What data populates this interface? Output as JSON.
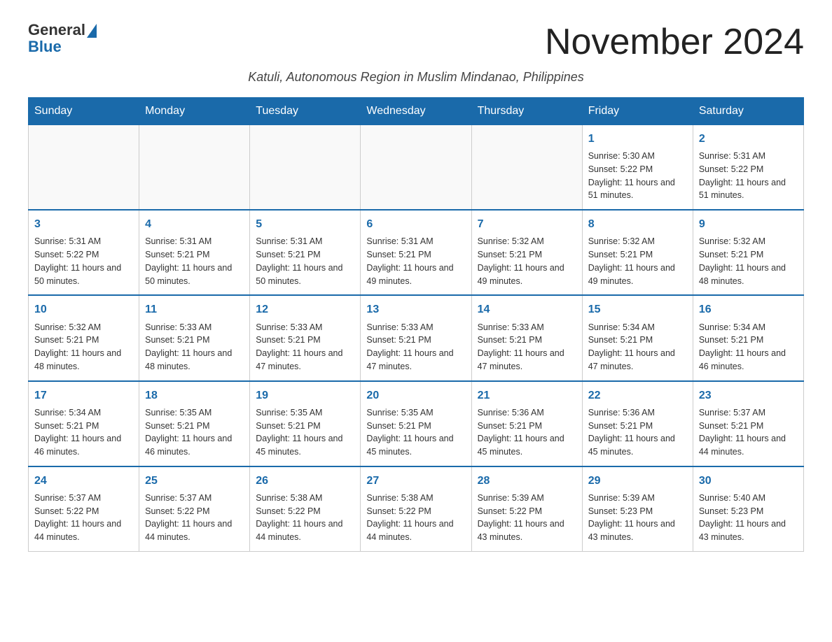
{
  "header": {
    "logo_general": "General",
    "logo_blue": "Blue",
    "month_title": "November 2024",
    "subtitle": "Katuli, Autonomous Region in Muslim Mindanao, Philippines"
  },
  "weekdays": [
    "Sunday",
    "Monday",
    "Tuesday",
    "Wednesday",
    "Thursday",
    "Friday",
    "Saturday"
  ],
  "weeks": [
    [
      {
        "day": "",
        "info": ""
      },
      {
        "day": "",
        "info": ""
      },
      {
        "day": "",
        "info": ""
      },
      {
        "day": "",
        "info": ""
      },
      {
        "day": "",
        "info": ""
      },
      {
        "day": "1",
        "info": "Sunrise: 5:30 AM\nSunset: 5:22 PM\nDaylight: 11 hours and 51 minutes."
      },
      {
        "day": "2",
        "info": "Sunrise: 5:31 AM\nSunset: 5:22 PM\nDaylight: 11 hours and 51 minutes."
      }
    ],
    [
      {
        "day": "3",
        "info": "Sunrise: 5:31 AM\nSunset: 5:22 PM\nDaylight: 11 hours and 50 minutes."
      },
      {
        "day": "4",
        "info": "Sunrise: 5:31 AM\nSunset: 5:21 PM\nDaylight: 11 hours and 50 minutes."
      },
      {
        "day": "5",
        "info": "Sunrise: 5:31 AM\nSunset: 5:21 PM\nDaylight: 11 hours and 50 minutes."
      },
      {
        "day": "6",
        "info": "Sunrise: 5:31 AM\nSunset: 5:21 PM\nDaylight: 11 hours and 49 minutes."
      },
      {
        "day": "7",
        "info": "Sunrise: 5:32 AM\nSunset: 5:21 PM\nDaylight: 11 hours and 49 minutes."
      },
      {
        "day": "8",
        "info": "Sunrise: 5:32 AM\nSunset: 5:21 PM\nDaylight: 11 hours and 49 minutes."
      },
      {
        "day": "9",
        "info": "Sunrise: 5:32 AM\nSunset: 5:21 PM\nDaylight: 11 hours and 48 minutes."
      }
    ],
    [
      {
        "day": "10",
        "info": "Sunrise: 5:32 AM\nSunset: 5:21 PM\nDaylight: 11 hours and 48 minutes."
      },
      {
        "day": "11",
        "info": "Sunrise: 5:33 AM\nSunset: 5:21 PM\nDaylight: 11 hours and 48 minutes."
      },
      {
        "day": "12",
        "info": "Sunrise: 5:33 AM\nSunset: 5:21 PM\nDaylight: 11 hours and 47 minutes."
      },
      {
        "day": "13",
        "info": "Sunrise: 5:33 AM\nSunset: 5:21 PM\nDaylight: 11 hours and 47 minutes."
      },
      {
        "day": "14",
        "info": "Sunrise: 5:33 AM\nSunset: 5:21 PM\nDaylight: 11 hours and 47 minutes."
      },
      {
        "day": "15",
        "info": "Sunrise: 5:34 AM\nSunset: 5:21 PM\nDaylight: 11 hours and 47 minutes."
      },
      {
        "day": "16",
        "info": "Sunrise: 5:34 AM\nSunset: 5:21 PM\nDaylight: 11 hours and 46 minutes."
      }
    ],
    [
      {
        "day": "17",
        "info": "Sunrise: 5:34 AM\nSunset: 5:21 PM\nDaylight: 11 hours and 46 minutes."
      },
      {
        "day": "18",
        "info": "Sunrise: 5:35 AM\nSunset: 5:21 PM\nDaylight: 11 hours and 46 minutes."
      },
      {
        "day": "19",
        "info": "Sunrise: 5:35 AM\nSunset: 5:21 PM\nDaylight: 11 hours and 45 minutes."
      },
      {
        "day": "20",
        "info": "Sunrise: 5:35 AM\nSunset: 5:21 PM\nDaylight: 11 hours and 45 minutes."
      },
      {
        "day": "21",
        "info": "Sunrise: 5:36 AM\nSunset: 5:21 PM\nDaylight: 11 hours and 45 minutes."
      },
      {
        "day": "22",
        "info": "Sunrise: 5:36 AM\nSunset: 5:21 PM\nDaylight: 11 hours and 45 minutes."
      },
      {
        "day": "23",
        "info": "Sunrise: 5:37 AM\nSunset: 5:21 PM\nDaylight: 11 hours and 44 minutes."
      }
    ],
    [
      {
        "day": "24",
        "info": "Sunrise: 5:37 AM\nSunset: 5:22 PM\nDaylight: 11 hours and 44 minutes."
      },
      {
        "day": "25",
        "info": "Sunrise: 5:37 AM\nSunset: 5:22 PM\nDaylight: 11 hours and 44 minutes."
      },
      {
        "day": "26",
        "info": "Sunrise: 5:38 AM\nSunset: 5:22 PM\nDaylight: 11 hours and 44 minutes."
      },
      {
        "day": "27",
        "info": "Sunrise: 5:38 AM\nSunset: 5:22 PM\nDaylight: 11 hours and 44 minutes."
      },
      {
        "day": "28",
        "info": "Sunrise: 5:39 AM\nSunset: 5:22 PM\nDaylight: 11 hours and 43 minutes."
      },
      {
        "day": "29",
        "info": "Sunrise: 5:39 AM\nSunset: 5:23 PM\nDaylight: 11 hours and 43 minutes."
      },
      {
        "day": "30",
        "info": "Sunrise: 5:40 AM\nSunset: 5:23 PM\nDaylight: 11 hours and 43 minutes."
      }
    ]
  ]
}
